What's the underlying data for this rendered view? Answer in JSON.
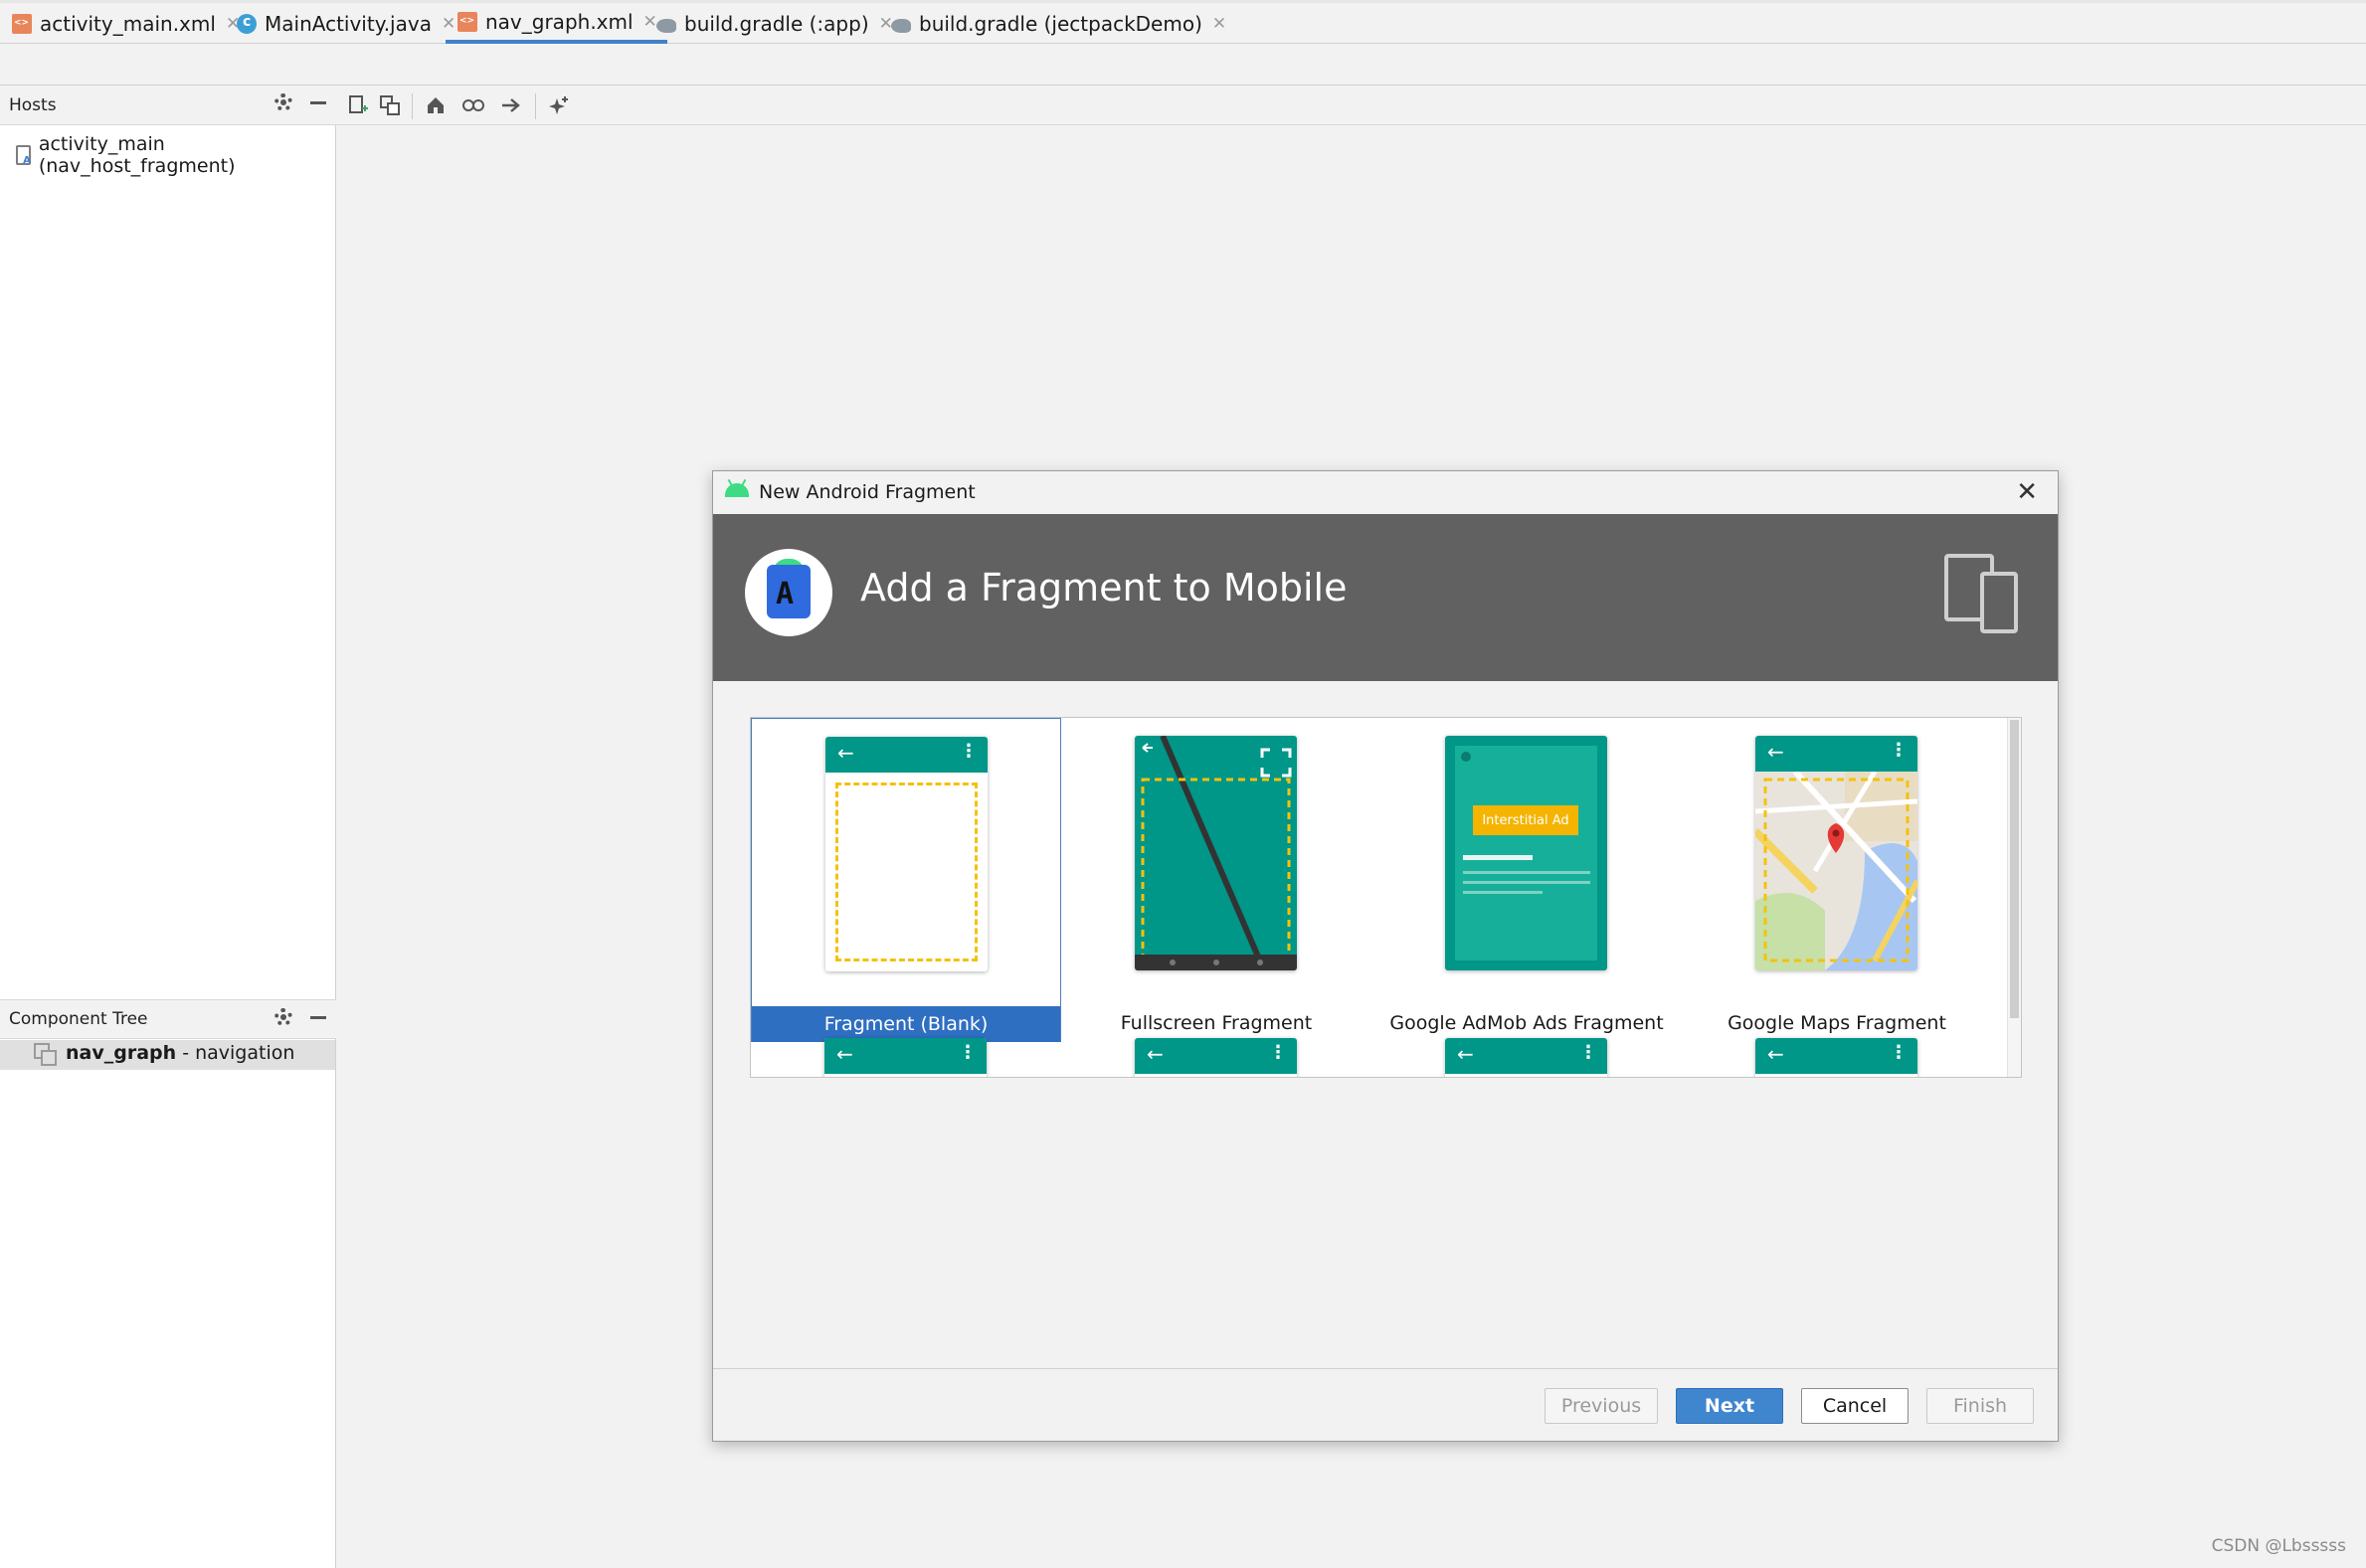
{
  "tabs": [
    {
      "label": "activity_main.xml",
      "icon": "xml-file-icon"
    },
    {
      "label": "MainActivity.java",
      "icon": "java-class-icon"
    },
    {
      "label": "nav_graph.xml",
      "icon": "xml-file-icon",
      "active": true
    },
    {
      "label": "build.gradle (:app)",
      "icon": "gradle-icon"
    },
    {
      "label": "build.gradle (jectpackDemo)",
      "icon": "gradle-icon"
    }
  ],
  "hosts_panel": {
    "title": "Hosts",
    "items": [
      "activity_main (nav_host_fragment)"
    ]
  },
  "component_tree": {
    "title": "Component Tree",
    "root_name": "nav_graph",
    "root_suffix": " - navigation"
  },
  "dialog": {
    "title": "New Android Fragment",
    "heading": "Add a Fragment to Mobile",
    "templates": [
      {
        "label": "Fragment (Blank)",
        "selected": true
      },
      {
        "label": "Fullscreen Fragment"
      },
      {
        "label": "Google AdMob Ads Fragment",
        "badge": "Interstitial Ad"
      },
      {
        "label": "Google Maps Fragment"
      },
      {
        "label": ""
      },
      {
        "label": ""
      },
      {
        "label": ""
      },
      {
        "label": ""
      }
    ],
    "buttons": {
      "previous": "Previous",
      "next": "Next",
      "cancel": "Cancel",
      "finish": "Finish"
    }
  },
  "watermark": "CSDN @Lbsssss",
  "colors": {
    "accent": "#3f86cf",
    "selection": "#2f6fc2",
    "appbar": "#009688",
    "banner": "#616161",
    "dashed_outline": "#f4c20d"
  }
}
